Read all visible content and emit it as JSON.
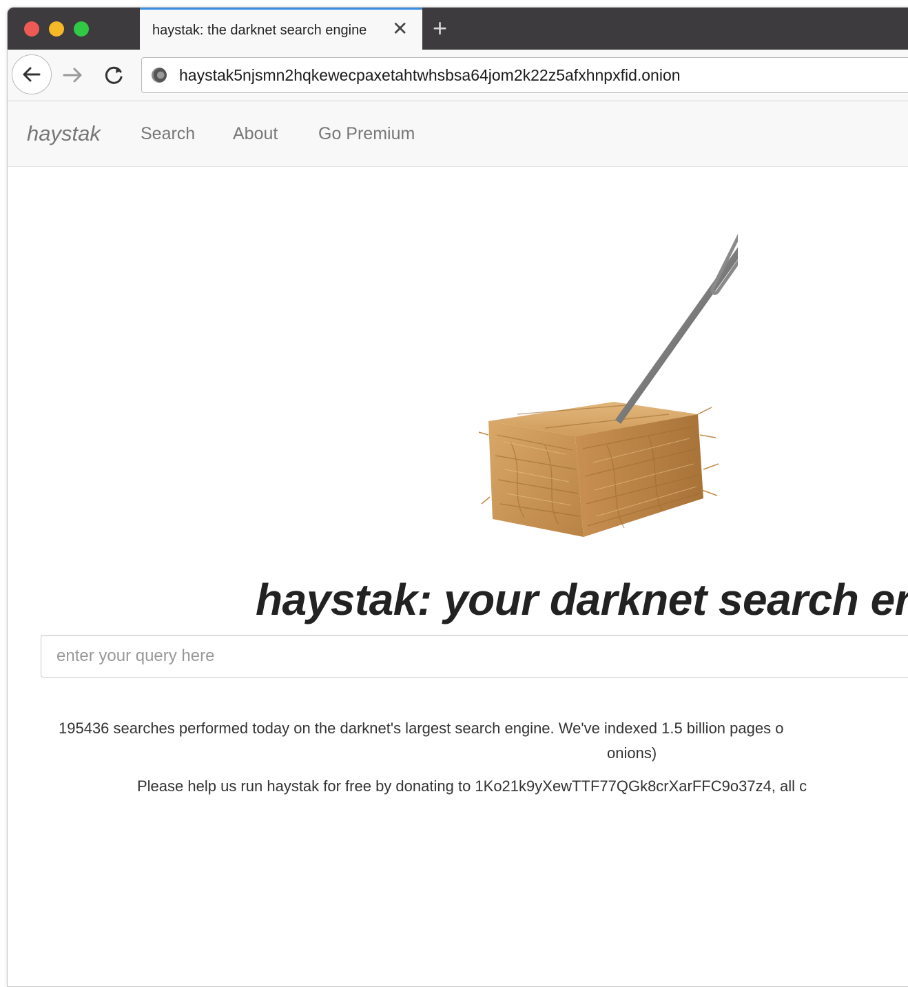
{
  "tab": {
    "title": "haystak: the darknet search engine",
    "close_icon": "close-icon",
    "new_tab_icon": "plus-icon"
  },
  "toolbar": {
    "url": "haystak5njsmn2hqkewecpaxetahtwhsbsa64jom2k22z5afxhnpxfid.onion"
  },
  "site_nav": {
    "brand": "haystak",
    "links": [
      {
        "label": "Search"
      },
      {
        "label": "About"
      },
      {
        "label": "Go Premium"
      }
    ]
  },
  "main": {
    "headline": "haystak: your darknet search er",
    "search": {
      "placeholder": "enter your query here",
      "value": ""
    },
    "stats_line1": "195436 searches performed today on the darknet's largest search engine. We've indexed 1.5 billion pages o",
    "stats_line2": "onions)",
    "donate": "Please help us run haystak for free by donating to 1Ko21k9yXewTTF77QGk8crXarFFC9o37z4, all c"
  },
  "colors": {
    "titlebar": "#3d3b3d",
    "tab_accent": "#3b8de0",
    "nav_text": "#777777",
    "headline": "#222222",
    "hay": "#c8934f"
  }
}
